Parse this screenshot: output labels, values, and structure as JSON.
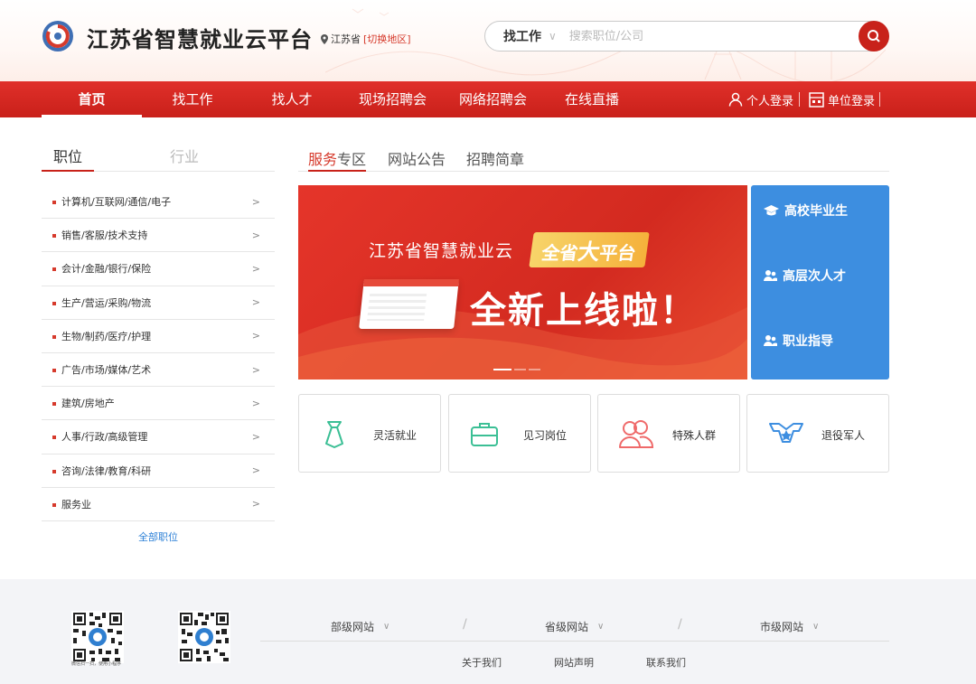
{
  "header": {
    "site_title": "江苏省智慧就业云平台",
    "location": "江苏省",
    "switch_region": "[切换地区]",
    "search": {
      "type_label": "找工作",
      "placeholder": "搜索职位/公司"
    }
  },
  "nav": {
    "items": [
      "首页",
      "找工作",
      "找人才",
      "现场招聘会",
      "网络招聘会",
      "在线直播"
    ],
    "active_index": 0,
    "personal_login": "个人登录",
    "company_login": "单位登录"
  },
  "left_panel": {
    "tabs": [
      "职位",
      "行业"
    ],
    "categories": [
      "计算机/互联网/通信/电子",
      "销售/客服/技术支持",
      "会计/金融/银行/保险",
      "生产/营运/采购/物流",
      "生物/制药/医疗/护理",
      "广告/市场/媒体/艺术",
      "建筑/房地产",
      "人事/行政/高级管理",
      "咨询/法律/教育/科研",
      "服务业"
    ],
    "all_link": "全部职位"
  },
  "right_panel": {
    "tab_service_red": "服务",
    "tab_service_rest": "专区",
    "tab_notice": "网站公告",
    "tab_brief": "招聘简章"
  },
  "banner": {
    "title": "江苏省智慧就业云",
    "badge_part1": "全省",
    "badge_part2": "大",
    "badge_part3": "平台",
    "main": "全新上线啦！"
  },
  "side_panel": {
    "items": [
      "高校毕业生",
      "高层次人才",
      "职业指导"
    ]
  },
  "cards": [
    {
      "label": "灵活就业",
      "icon": "tie-icon"
    },
    {
      "label": "见习岗位",
      "icon": "briefcase-icon"
    },
    {
      "label": "特殊人群",
      "icon": "people-icon"
    },
    {
      "label": "退役军人",
      "icon": "military-badge-icon"
    }
  ],
  "footer": {
    "qr_caption": "微信扫一扫，使用小程序",
    "ministry_sites": "部级网站",
    "province_sites": "省级网站",
    "city_sites": "市级网站",
    "about": "关于我们",
    "statement": "网站声明",
    "contact": "联系我们"
  },
  "colors": {
    "brand_red": "#c8221a",
    "accent_blue": "#3d8ee0",
    "link_blue": "#2b7fd6"
  }
}
